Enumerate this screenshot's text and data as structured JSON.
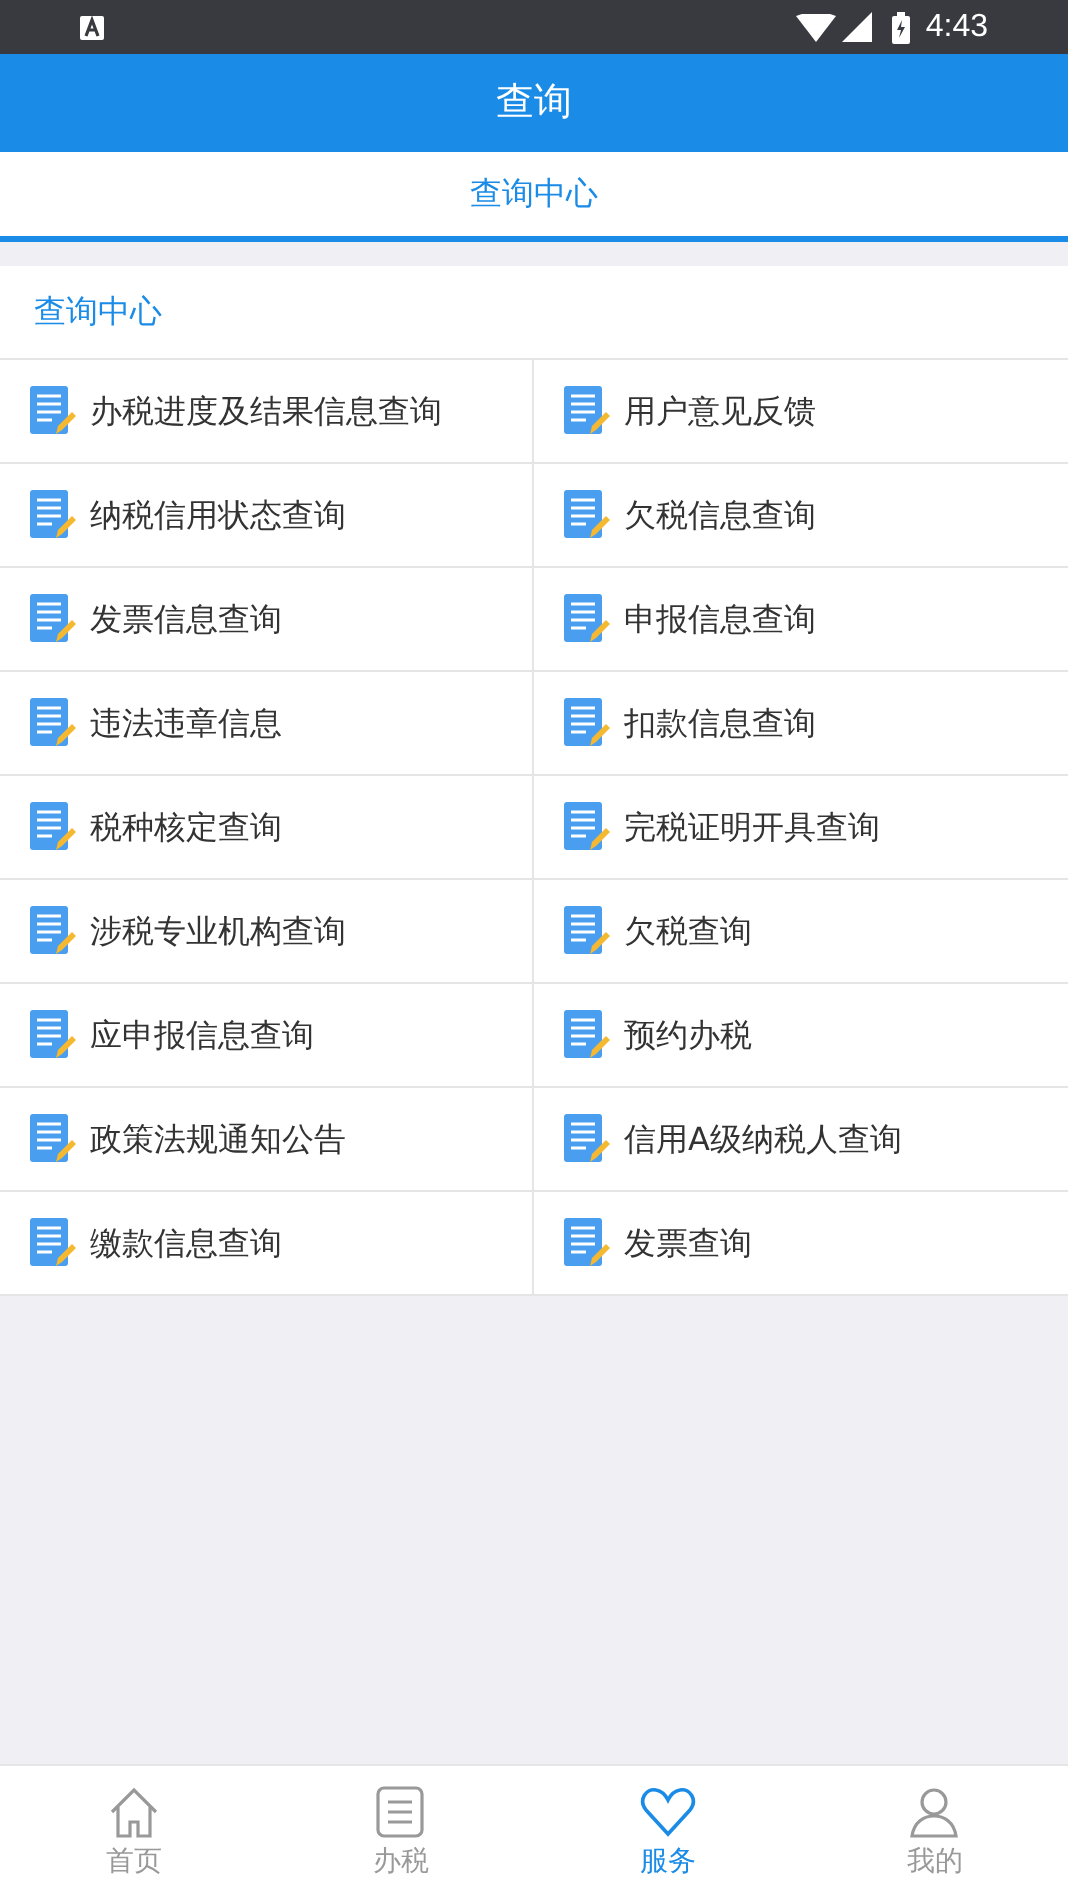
{
  "status_bar": {
    "time": "4:43"
  },
  "header": {
    "title": "查询"
  },
  "tabs": [
    {
      "label": "查询中心",
      "selected": true
    }
  ],
  "section": {
    "title": "查询中心",
    "items": [
      {
        "label": "办税进度及结果信息查询"
      },
      {
        "label": "用户意见反馈"
      },
      {
        "label": "纳税信用状态查询"
      },
      {
        "label": "欠税信息查询"
      },
      {
        "label": "发票信息查询"
      },
      {
        "label": "申报信息查询"
      },
      {
        "label": "违法违章信息"
      },
      {
        "label": "扣款信息查询"
      },
      {
        "label": "税种核定查询"
      },
      {
        "label": "完税证明开具查询"
      },
      {
        "label": "涉税专业机构查询"
      },
      {
        "label": "欠税查询"
      },
      {
        "label": "应申报信息查询"
      },
      {
        "label": "预约办税"
      },
      {
        "label": "政策法规通知公告"
      },
      {
        "label": "信用A级纳税人查询"
      },
      {
        "label": "缴款信息查询"
      },
      {
        "label": "发票查询"
      }
    ]
  },
  "bottom_nav": [
    {
      "label": "首页",
      "kind": "home",
      "selected": false
    },
    {
      "label": "办税",
      "kind": "list",
      "selected": false
    },
    {
      "label": "服务",
      "kind": "heart",
      "selected": true
    },
    {
      "label": "我的",
      "kind": "person",
      "selected": false
    }
  ]
}
